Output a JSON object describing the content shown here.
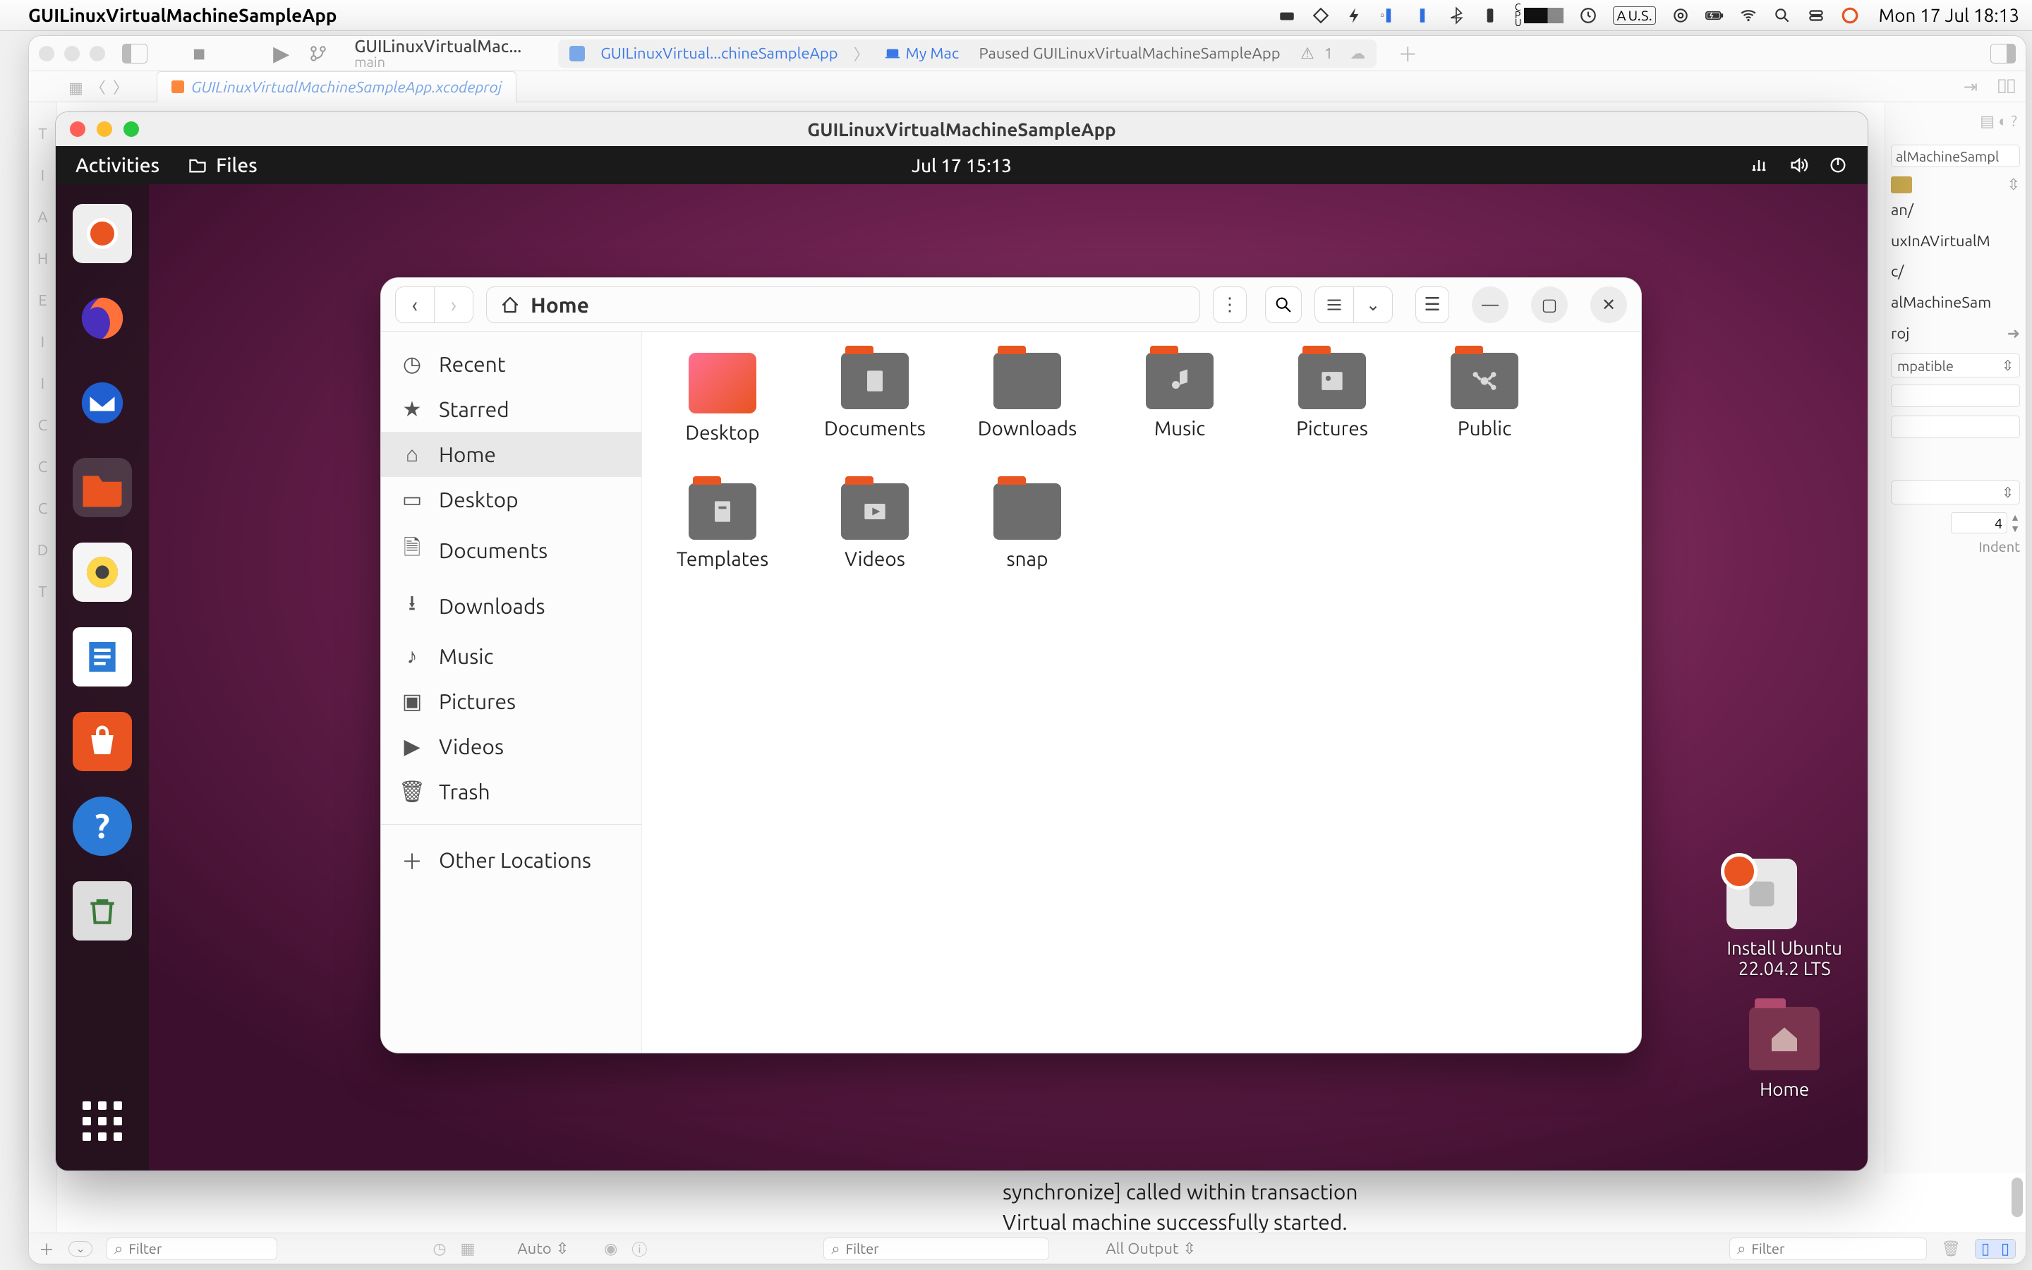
{
  "mac_menubar": {
    "app_title": "GUILinuxVirtualMachineSampleApp",
    "keyboard_lang": "U.S.",
    "clock": "Mon 17 Jul  18:13"
  },
  "xcode": {
    "scheme_title": "GUILinuxVirtualMac...",
    "scheme_branch": "main",
    "status_scheme": "GUILinuxVirtual...chineSampleApp",
    "status_device": "My Mac",
    "status_state": "Paused GUILinuxVirtualMachineSampleApp",
    "warning_count": "1",
    "tab_title": "GUILinuxVirtualMachineSampleApp.xcodeproj",
    "inspector": {
      "name_truncated": "alMachineSampl",
      "location_1": "an/",
      "location_2": "uxInAVirtualM",
      "location_3": "c/",
      "location_4": "alMachineSam",
      "location_5": "roj",
      "compat": "mpatible",
      "indent": "4",
      "indent_label": "Indent"
    },
    "console_line1": "synchronize] called within transaction",
    "console_line2": "Virtual machine successfully started.",
    "bottombar": {
      "filter_ph": "Filter",
      "auto": "Auto",
      "all_output": "All Output"
    }
  },
  "vm": {
    "window_title": "GUILinuxVirtualMachineSampleApp"
  },
  "ubuntu_topbar": {
    "activities": "Activities",
    "files": "Files",
    "datetime": "Jul 17  15:13"
  },
  "ubuntu_desktop": {
    "install_label": "Install Ubuntu\n22.04.2 LTS",
    "home_label": "Home"
  },
  "nautilus": {
    "path": "Home",
    "sidebar": [
      {
        "label": "Recent"
      },
      {
        "label": "Starred"
      },
      {
        "label": "Home"
      },
      {
        "label": "Desktop"
      },
      {
        "label": "Documents"
      },
      {
        "label": "Downloads"
      },
      {
        "label": "Music"
      },
      {
        "label": "Pictures"
      },
      {
        "label": "Videos"
      },
      {
        "label": "Trash"
      },
      {
        "label": "Other Locations"
      }
    ],
    "folders": [
      {
        "label": "Desktop"
      },
      {
        "label": "Documents"
      },
      {
        "label": "Downloads"
      },
      {
        "label": "Music"
      },
      {
        "label": "Pictures"
      },
      {
        "label": "Public"
      },
      {
        "label": "Templates"
      },
      {
        "label": "Videos"
      },
      {
        "label": "snap"
      }
    ]
  }
}
